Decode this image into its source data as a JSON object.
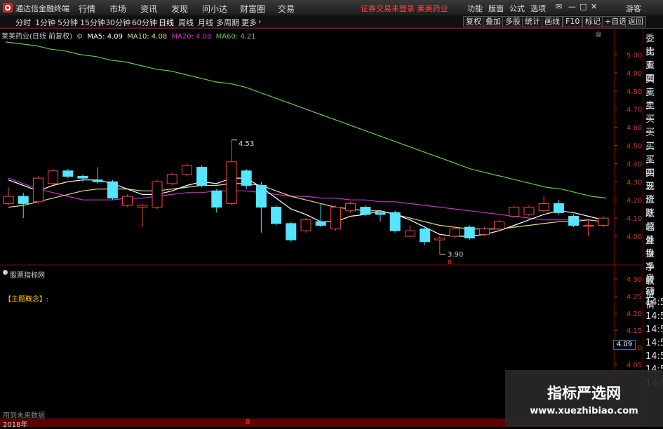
{
  "topbar": {
    "app_title": "通达信金融终端",
    "menus": [
      "行情",
      "市场",
      "资讯",
      "发现",
      "问小达",
      "财富圈",
      "交易"
    ],
    "notice": "证券交易未登录  莱美药业",
    "right_menus": [
      "功能",
      "版面",
      "公式",
      "选项"
    ],
    "guest": "游客"
  },
  "periods": [
    "分时",
    "1分钟",
    "5分钟",
    "15分钟",
    "30分钟",
    "60分钟",
    "日线",
    "周线",
    "月线",
    "多周期",
    "更多"
  ],
  "active_period": "日线",
  "toolbar": [
    "复权",
    "叠加",
    "多股",
    "统计",
    "画线",
    "F10",
    "标记",
    "+自选",
    "返回"
  ],
  "legend": {
    "stock": "莱美药业(日线 前复权)",
    "ma5": "MA5: 4.09",
    "ma10": "MA10: 4.08",
    "ma20": "MA20: 4.08",
    "ma60": "MA60: 4.21"
  },
  "colors": {
    "ma5": "#ffffff",
    "ma10": "#e8d890",
    "ma20": "#cc33cc",
    "ma60": "#66cc44",
    "up": "#ff4444",
    "down": "#55e5ff",
    "axis": "#cc3333"
  },
  "right_panel": [
    "委比",
    "卖五",
    "卖四",
    "卖三",
    "卖二",
    "卖一",
    "买一",
    "买二",
    "买三",
    "买四",
    "买五",
    "现价",
    "涨跌",
    "涨幅",
    "总量",
    "外盘",
    "换手",
    "净资",
    "收益",
    "自动",
    "行情",
    "14:5",
    "14:5",
    "14:5",
    "14:5",
    "14:5",
    "14:5",
    "14:5"
  ],
  "price_axis": [
    "5.00",
    "4.90",
    "4.80",
    "4.70",
    "4.60",
    "4.50",
    "4.40",
    "4.30",
    "4.20",
    "4.10",
    "4.00"
  ],
  "ind_axis": [
    "4.30",
    "4.25",
    "4.20",
    "4.15",
    "4.10",
    "4.05"
  ],
  "price_box": "4.09",
  "annotations": {
    "high": "4.53",
    "low": "3.90",
    "marker": "8"
  },
  "indicator": {
    "title": "股票指标网",
    "concept": "【主题概念】:"
  },
  "future_text": "用到未来数据",
  "bottom": {
    "year": "2018年",
    "mark": "8"
  },
  "watermark": {
    "title": "指标严选网",
    "url": "www.xuezhibiao.com"
  },
  "chart_data": {
    "type": "candlestick",
    "candles": [
      {
        "o": 4.18,
        "c": 4.22,
        "h": 4.27,
        "l": 4.17
      },
      {
        "o": 4.22,
        "c": 4.18,
        "h": 4.24,
        "l": 4.1
      },
      {
        "o": 4.19,
        "c": 4.32,
        "h": 4.33,
        "l": 4.18
      },
      {
        "o": 4.29,
        "c": 4.36,
        "h": 4.37,
        "l": 4.28
      },
      {
        "o": 4.36,
        "c": 4.33,
        "h": 4.37,
        "l": 4.32
      },
      {
        "o": 4.33,
        "c": 4.32,
        "h": 4.34,
        "l": 4.3
      },
      {
        "o": 4.31,
        "c": 4.3,
        "h": 4.38,
        "l": 4.29
      },
      {
        "o": 4.3,
        "c": 4.21,
        "h": 4.31,
        "l": 4.2
      },
      {
        "o": 4.17,
        "c": 4.22,
        "h": 4.23,
        "l": 4.16
      },
      {
        "o": 4.16,
        "c": 4.17,
        "h": 4.18,
        "l": 4.05
      },
      {
        "o": 4.16,
        "c": 4.3,
        "h": 4.31,
        "l": 4.15
      },
      {
        "o": 4.29,
        "c": 4.34,
        "h": 4.35,
        "l": 4.28
      },
      {
        "o": 4.34,
        "c": 4.39,
        "h": 4.4,
        "l": 4.33
      },
      {
        "o": 4.38,
        "c": 4.28,
        "h": 4.39,
        "l": 4.27
      },
      {
        "o": 4.25,
        "c": 4.16,
        "h": 4.26,
        "l": 4.13
      },
      {
        "o": 4.18,
        "c": 4.41,
        "h": 4.53,
        "l": 4.17
      },
      {
        "o": 4.36,
        "c": 4.28,
        "h": 4.37,
        "l": 4.26
      },
      {
        "o": 4.28,
        "c": 4.16,
        "h": 4.3,
        "l": 4.02
      },
      {
        "o": 4.16,
        "c": 4.07,
        "h": 4.17,
        "l": 4.06
      },
      {
        "o": 4.07,
        "c": 3.98,
        "h": 4.08,
        "l": 3.97
      },
      {
        "o": 4.03,
        "c": 4.09,
        "h": 4.1,
        "l": 4.02
      },
      {
        "o": 4.08,
        "c": 4.06,
        "h": 4.18,
        "l": 4.05
      },
      {
        "o": 4.04,
        "c": 4.16,
        "h": 4.17,
        "l": 4.03
      },
      {
        "o": 4.14,
        "c": 4.18,
        "h": 4.19,
        "l": 4.13
      },
      {
        "o": 4.16,
        "c": 4.12,
        "h": 4.17,
        "l": 4.11
      },
      {
        "o": 4.13,
        "c": 4.12,
        "h": 4.14,
        "l": 4.08
      },
      {
        "o": 4.13,
        "c": 4.03,
        "h": 4.14,
        "l": 4.02
      },
      {
        "o": 4.0,
        "c": 4.03,
        "h": 4.06,
        "l": 3.99
      },
      {
        "o": 4.04,
        "c": 3.97,
        "h": 4.05,
        "l": 3.95
      },
      {
        "o": 3.98,
        "c": 3.99,
        "h": 4.0,
        "l": 3.9
      },
      {
        "o": 4.0,
        "c": 4.04,
        "h": 4.05,
        "l": 3.99
      },
      {
        "o": 4.05,
        "c": 3.99,
        "h": 4.06,
        "l": 3.98
      },
      {
        "o": 4.01,
        "c": 4.04,
        "h": 4.05,
        "l": 4.0
      },
      {
        "o": 4.04,
        "c": 4.08,
        "h": 4.09,
        "l": 4.03
      },
      {
        "o": 4.11,
        "c": 4.16,
        "h": 4.17,
        "l": 4.1
      },
      {
        "o": 4.12,
        "c": 4.16,
        "h": 4.17,
        "l": 4.11
      },
      {
        "o": 4.14,
        "c": 4.18,
        "h": 4.22,
        "l": 4.13
      },
      {
        "o": 4.18,
        "c": 4.13,
        "h": 4.2,
        "l": 4.12
      },
      {
        "o": 4.11,
        "c": 4.06,
        "h": 4.12,
        "l": 4.05
      },
      {
        "o": 4.06,
        "c": 4.06,
        "h": 4.09,
        "l": 4.0
      },
      {
        "o": 4.06,
        "c": 4.1,
        "h": 4.11,
        "l": 4.05
      }
    ],
    "ma5": [
      4.31,
      4.28,
      4.25,
      4.28,
      4.3,
      4.31,
      4.31,
      4.29,
      4.26,
      4.23,
      4.23,
      4.25,
      4.28,
      4.3,
      4.29,
      4.32,
      4.32,
      4.27,
      4.21,
      4.15,
      4.12,
      4.08,
      4.08,
      4.11,
      4.12,
      4.14,
      4.12,
      4.09,
      4.05,
      4.01,
      4.0,
      4.0,
      4.01,
      4.03,
      4.06,
      4.09,
      4.12,
      4.14,
      4.13,
      4.11,
      4.09
    ],
    "ma10": [
      4.16,
      4.17,
      4.19,
      4.21,
      4.23,
      4.25,
      4.26,
      4.26,
      4.26,
      4.25,
      4.25,
      4.26,
      4.27,
      4.28,
      4.28,
      4.29,
      4.29,
      4.28,
      4.25,
      4.22,
      4.2,
      4.18,
      4.16,
      4.15,
      4.14,
      4.14,
      4.12,
      4.1,
      4.08,
      4.06,
      4.05,
      4.04,
      4.04,
      4.04,
      4.05,
      4.06,
      4.07,
      4.08,
      4.08,
      4.09,
      4.08
    ],
    "ma20": [
      4.32,
      4.29,
      4.26,
      4.24,
      4.22,
      4.2,
      4.2,
      4.2,
      4.21,
      4.21,
      4.22,
      4.23,
      4.24,
      4.24,
      4.25,
      4.25,
      4.25,
      4.24,
      4.23,
      4.22,
      4.22,
      4.21,
      4.21,
      4.2,
      4.2,
      4.19,
      4.19,
      4.18,
      4.17,
      4.16,
      4.15,
      4.14,
      4.13,
      4.12,
      4.11,
      4.1,
      4.09,
      4.09,
      4.09,
      4.09,
      4.08
    ],
    "ma60": [
      5.07,
      5.06,
      5.05,
      5.03,
      5.02,
      5.0,
      4.99,
      4.97,
      4.96,
      4.94,
      4.92,
      4.91,
      4.89,
      4.87,
      4.85,
      4.84,
      4.82,
      4.79,
      4.76,
      4.73,
      4.7,
      4.67,
      4.64,
      4.61,
      4.58,
      4.55,
      4.52,
      4.49,
      4.46,
      4.43,
      4.4,
      4.37,
      4.35,
      4.33,
      4.31,
      4.29,
      4.27,
      4.26,
      4.24,
      4.22,
      4.21
    ],
    "ylim": [
      3.88,
      5.1
    ],
    "ylim_indicator": [
      4.03,
      4.32
    ]
  }
}
